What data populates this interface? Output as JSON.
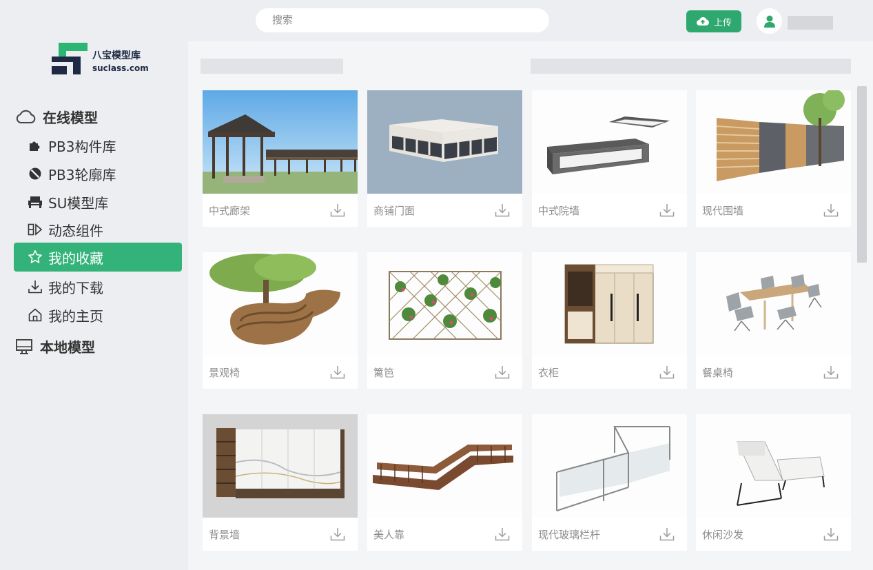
{
  "header": {
    "search_placeholder": "搜索",
    "upload_label": "上传"
  },
  "brand": {
    "name": "八宝模型库",
    "domain": "suclass.com"
  },
  "sidebar": {
    "online_section": "在线模型",
    "items": [
      {
        "label": "PB3构件库",
        "icon": "puzzle-icon"
      },
      {
        "label": "PB3轮廓库",
        "icon": "ban-circle-icon"
      },
      {
        "label": "SU模型库",
        "icon": "sofa-icon"
      },
      {
        "label": "动态组件",
        "icon": "dynamic-component-icon"
      },
      {
        "label": "我的收藏",
        "icon": "star-icon",
        "active": true
      },
      {
        "label": "我的下载",
        "icon": "download-icon"
      },
      {
        "label": "我的主页",
        "icon": "home-icon"
      }
    ],
    "local_section": "本地模型"
  },
  "models": [
    {
      "title": "中式廊架"
    },
    {
      "title": "商铺门面"
    },
    {
      "title": "中式院墙"
    },
    {
      "title": "现代围墙"
    },
    {
      "title": "景观椅"
    },
    {
      "title": "篱笆"
    },
    {
      "title": "衣柜"
    },
    {
      "title": "餐桌椅"
    },
    {
      "title": "背景墙"
    },
    {
      "title": "美人靠"
    },
    {
      "title": "现代玻璃栏杆"
    },
    {
      "title": "休闲沙发"
    }
  ],
  "colors": {
    "accent": "#33b37a",
    "upload": "#2fa86f",
    "brand_green": "#2bb673",
    "brand_navy": "#1e2a44"
  }
}
